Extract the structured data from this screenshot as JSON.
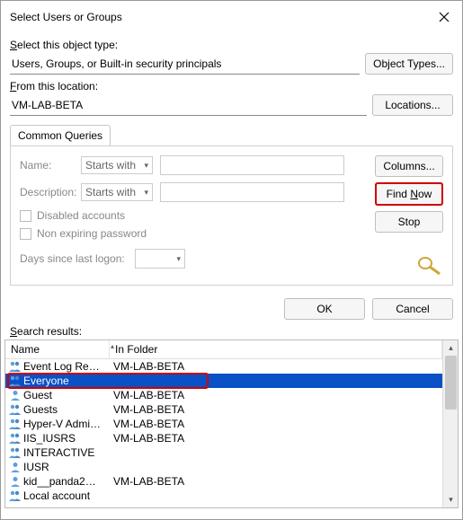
{
  "title": "Select Users or Groups",
  "object_type": {
    "label_pre": "S",
    "label_post": "elect this object type:",
    "value": "Users, Groups, or Built-in security principals",
    "button": "Object Types..."
  },
  "location": {
    "label_pre": "F",
    "label_post": "rom this location:",
    "value": "VM-LAB-BETA",
    "button": "Locations..."
  },
  "tab_label": "Common Queries",
  "queries": {
    "name_label": "Name:",
    "desc_label": "Description:",
    "starts_with": "Starts with",
    "disabled_accounts": "Disabled accounts",
    "non_expiring": "Non expiring password",
    "days_label": "Days since last logon:"
  },
  "buttons": {
    "columns": "Columns...",
    "find_now": "Find Now",
    "stop": "Stop",
    "ok": "OK",
    "cancel": "Cancel"
  },
  "results_label": "Search results:",
  "columns": {
    "name": "Name",
    "folder": "In Folder"
  },
  "rows": [
    {
      "name": "Event Log Re…",
      "folder": "VM-LAB-BETA",
      "type": "group"
    },
    {
      "name": "Everyone",
      "folder": "",
      "type": "group",
      "selected": true
    },
    {
      "name": "Guest",
      "folder": "VM-LAB-BETA",
      "type": "user"
    },
    {
      "name": "Guests",
      "folder": "VM-LAB-BETA",
      "type": "group"
    },
    {
      "name": "Hyper-V Admi…",
      "folder": "VM-LAB-BETA",
      "type": "group"
    },
    {
      "name": "IIS_IUSRS",
      "folder": "VM-LAB-BETA",
      "type": "group"
    },
    {
      "name": "INTERACTIVE",
      "folder": "",
      "type": "group"
    },
    {
      "name": "IUSR",
      "folder": "",
      "type": "user"
    },
    {
      "name": "kid__panda2…",
      "folder": "VM-LAB-BETA",
      "type": "user"
    },
    {
      "name": "Local account",
      "folder": "",
      "type": "group"
    }
  ]
}
